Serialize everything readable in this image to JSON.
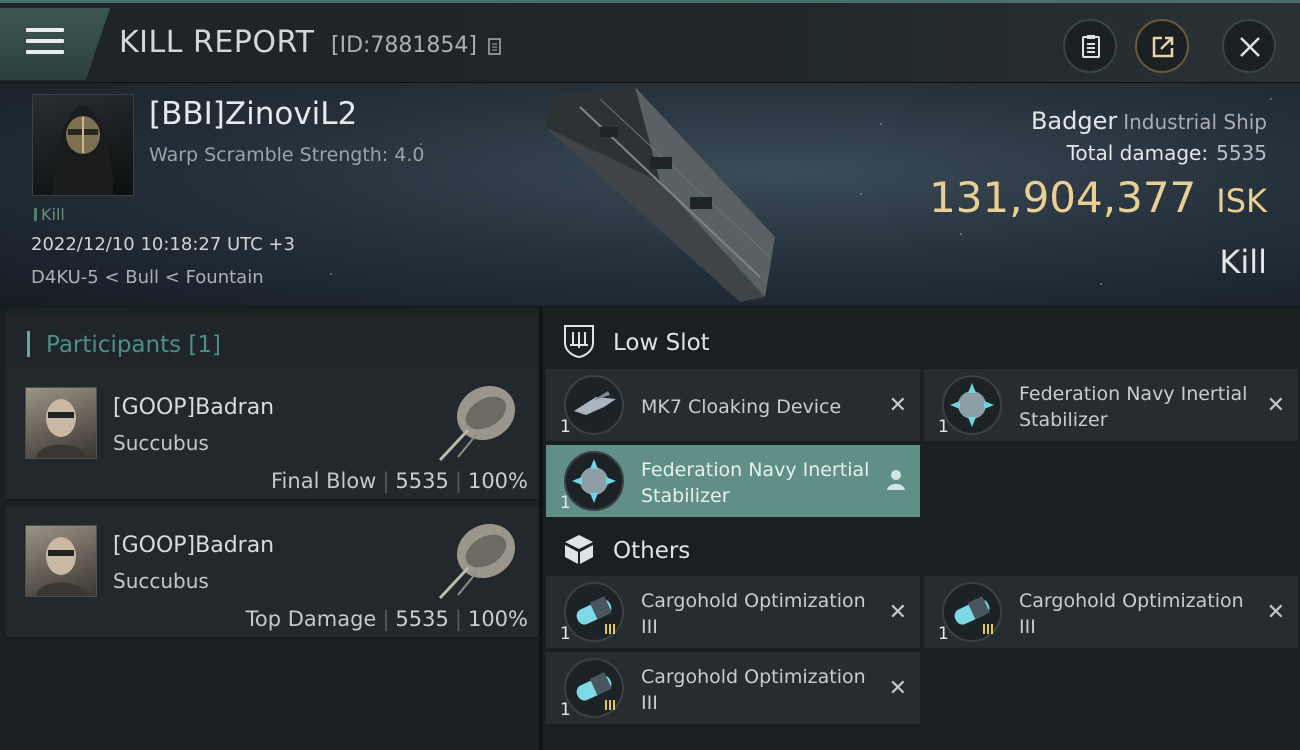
{
  "header": {
    "title": "KILL REPORT",
    "report_id": "[ID:7881854]",
    "buttons": [
      "clipboard-icon",
      "share-icon",
      "close-icon"
    ]
  },
  "victim": {
    "name": "[BBI]ZinoviL2",
    "warp_scramble": "Warp Scramble Strength: 4.0",
    "kill_tag": "Kill",
    "datetime": "2022/12/10 10:18:27 UTC +3",
    "location": "D4KU-5 < Bull < Fountain",
    "ship_name": "Badger",
    "ship_class": "Industrial Ship",
    "total_damage_label": "Total damage:",
    "total_damage_value": "5535",
    "isk_value": "131,904,377",
    "isk_unit": "ISK",
    "result": "Kill"
  },
  "participants": {
    "title": "Participants [1]",
    "rows": [
      {
        "name": "[GOOP]Badran",
        "ship": "Succubus",
        "role": "Final Blow",
        "damage": "5535",
        "percent": "100%"
      },
      {
        "name": "[GOOP]Badran",
        "ship": "Succubus",
        "role": "Top Damage",
        "damage": "5535",
        "percent": "100%"
      }
    ]
  },
  "fittings": {
    "low_slot_label": "Low Slot",
    "others_label": "Others",
    "low_slot": [
      {
        "name": "MK7 Cloaking Device",
        "qty": "1",
        "status": "destroyed",
        "icon": "cloak-module-icon"
      },
      {
        "name": "Federation Navy Inertial Stabilizer",
        "qty": "1",
        "status": "destroyed",
        "icon": "stabilizer-module-icon"
      },
      {
        "name": "Federation Navy Inertial Stabilizer",
        "qty": "1",
        "status": "dropped",
        "icon": "stabilizer-module-icon"
      }
    ],
    "others": [
      {
        "name": "Cargohold Optimization III",
        "qty": "1",
        "status": "destroyed",
        "icon": "cargohold-rig-icon"
      },
      {
        "name": "Cargohold Optimization III",
        "qty": "1",
        "status": "destroyed",
        "icon": "cargohold-rig-icon"
      },
      {
        "name": "Cargohold Optimization III",
        "qty": "1",
        "status": "destroyed",
        "icon": "cargohold-rig-icon"
      }
    ],
    "destroyed_mark": "✕"
  },
  "colors": {
    "accent": "#5fa9a1",
    "isk": "#e9cf92",
    "selected": "#5f8f87"
  }
}
